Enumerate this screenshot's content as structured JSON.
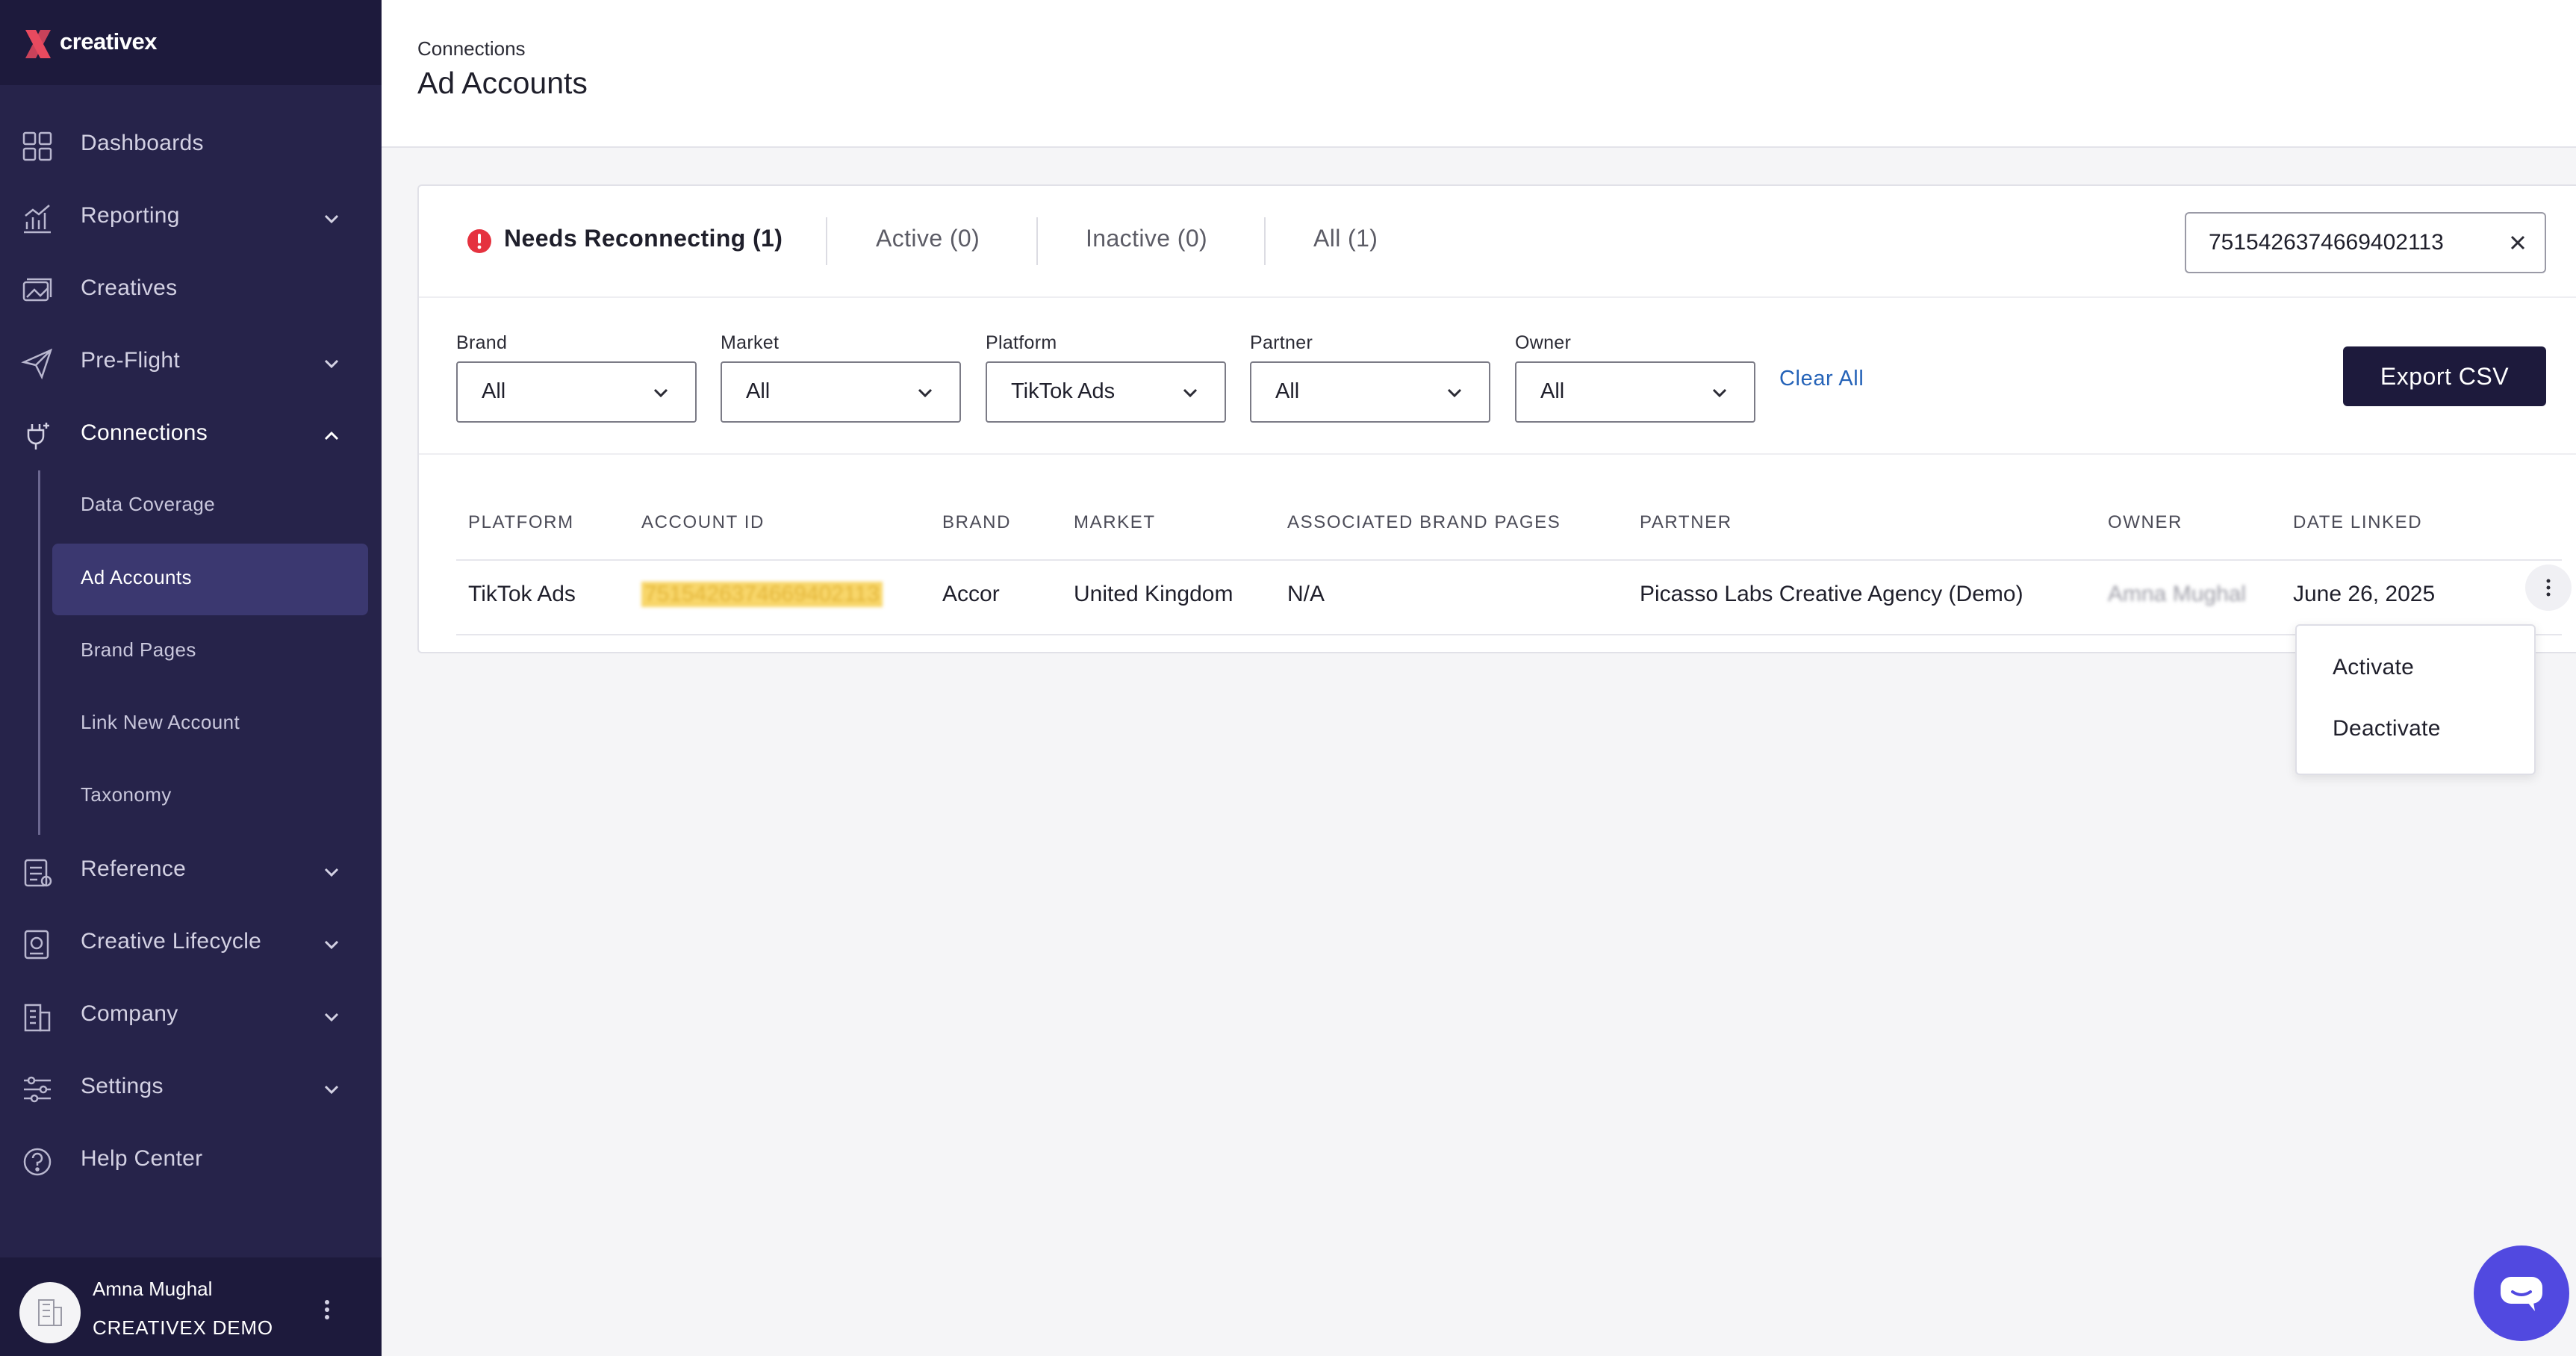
{
  "sidebar": {
    "brand": "creativex",
    "nav": [
      {
        "label": "Dashboards",
        "icon": "dashboard-grid-icon"
      },
      {
        "label": "Reporting",
        "icon": "chart-icon"
      },
      {
        "label": "Creatives",
        "icon": "creatives-icon"
      },
      {
        "label": "Pre-Flight",
        "icon": "paper-plane-icon"
      },
      {
        "label": "Connections",
        "icon": "plug-icon"
      },
      {
        "label": "Reference",
        "icon": "clipboard-icon"
      },
      {
        "label": "Creative Lifecycle",
        "icon": "lifecycle-icon"
      },
      {
        "label": "Company",
        "icon": "building-icon"
      },
      {
        "label": "Settings",
        "icon": "sliders-icon"
      },
      {
        "label": "Help Center",
        "icon": "help-icon"
      }
    ],
    "connections_sub": [
      "Data Coverage",
      "Ad Accounts",
      "Brand Pages",
      "Link New Account",
      "Taxonomy"
    ],
    "user": {
      "name": "Amna Mughal",
      "org": "CREATIVEX DEMO"
    }
  },
  "header": {
    "breadcrumb": "Connections",
    "title": "Ad Accounts"
  },
  "tabs": [
    {
      "label": "Needs Reconnecting (1)"
    },
    {
      "label": "Active (0)"
    },
    {
      "label": "Inactive (0)"
    },
    {
      "label": "All (1)"
    }
  ],
  "search": {
    "value": "7515426374669402113"
  },
  "filters": [
    {
      "label": "Brand",
      "value": "All"
    },
    {
      "label": "Market",
      "value": "All"
    },
    {
      "label": "Platform",
      "value": "TikTok Ads"
    },
    {
      "label": "Partner",
      "value": "All"
    },
    {
      "label": "Owner",
      "value": "All"
    }
  ],
  "clear_all": "Clear All",
  "export": "Export CSV",
  "table": {
    "columns": [
      "PLATFORM",
      "ACCOUNT ID",
      "BRAND",
      "MARKET",
      "ASSOCIATED BRAND PAGES",
      "PARTNER",
      "OWNER",
      "DATE LINKED"
    ],
    "rows": [
      {
        "platform": "TikTok Ads",
        "account_id": "7515426374669402113",
        "brand": "Accor",
        "market": "United Kingdom",
        "pages": "N/A",
        "partner": "Picasso Labs Creative Agency (Demo)",
        "owner": "Amna Mughal",
        "date": "June 26, 2025"
      }
    ]
  },
  "row_menu": [
    "Activate",
    "Deactivate"
  ],
  "colors": {
    "sidebar_bg": "#26234a",
    "sidebar_dark": "#1d1a3c",
    "accent": "#e84a5f",
    "link": "#2563b8",
    "chat": "#5149e0",
    "warning": "#e5323f"
  }
}
